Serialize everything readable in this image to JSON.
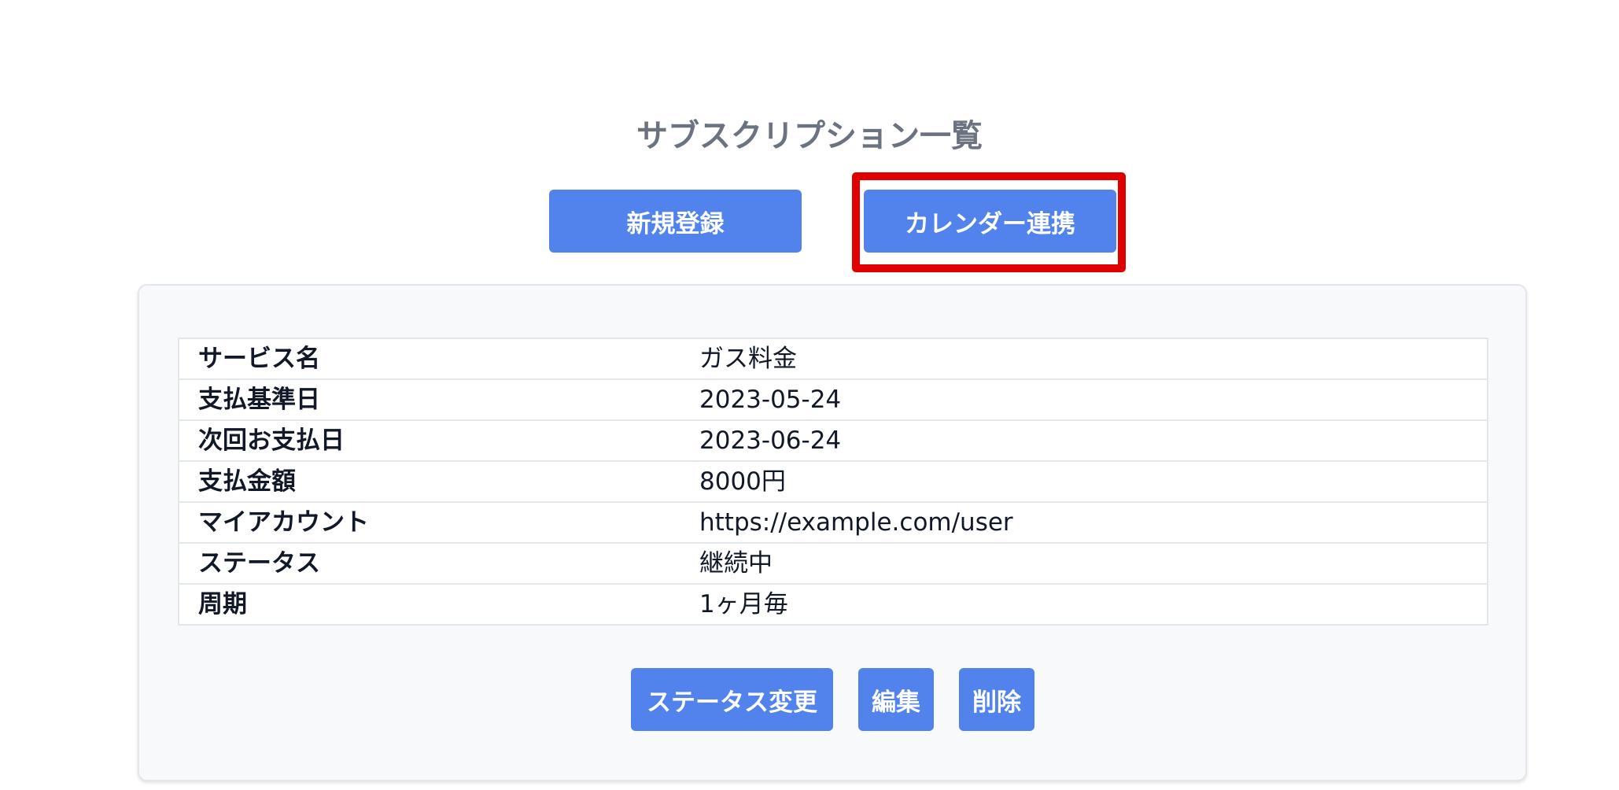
{
  "page": {
    "title": "サブスクリプション一覧"
  },
  "header_buttons": {
    "new_label": "新規登録",
    "calendar_label": "カレンダー連携"
  },
  "details": {
    "rows": [
      {
        "label": "サービス名",
        "value": "ガス料金"
      },
      {
        "label": "支払基準日",
        "value": "2023-05-24"
      },
      {
        "label": "次回お支払日",
        "value": "2023-06-24"
      },
      {
        "label": "支払金額",
        "value": "8000円"
      },
      {
        "label": "マイアカウント",
        "value": "https://example.com/user"
      },
      {
        "label": "ステータス",
        "value": "継続中"
      },
      {
        "label": "周期",
        "value": "1ヶ月毎"
      }
    ]
  },
  "actions": {
    "status_change_label": "ステータス変更",
    "edit_label": "編集",
    "delete_label": "削除"
  },
  "colors": {
    "button": "#5283ec",
    "highlight": "#e00000",
    "title": "#6b7280",
    "card_bg": "#f8f9fb"
  }
}
